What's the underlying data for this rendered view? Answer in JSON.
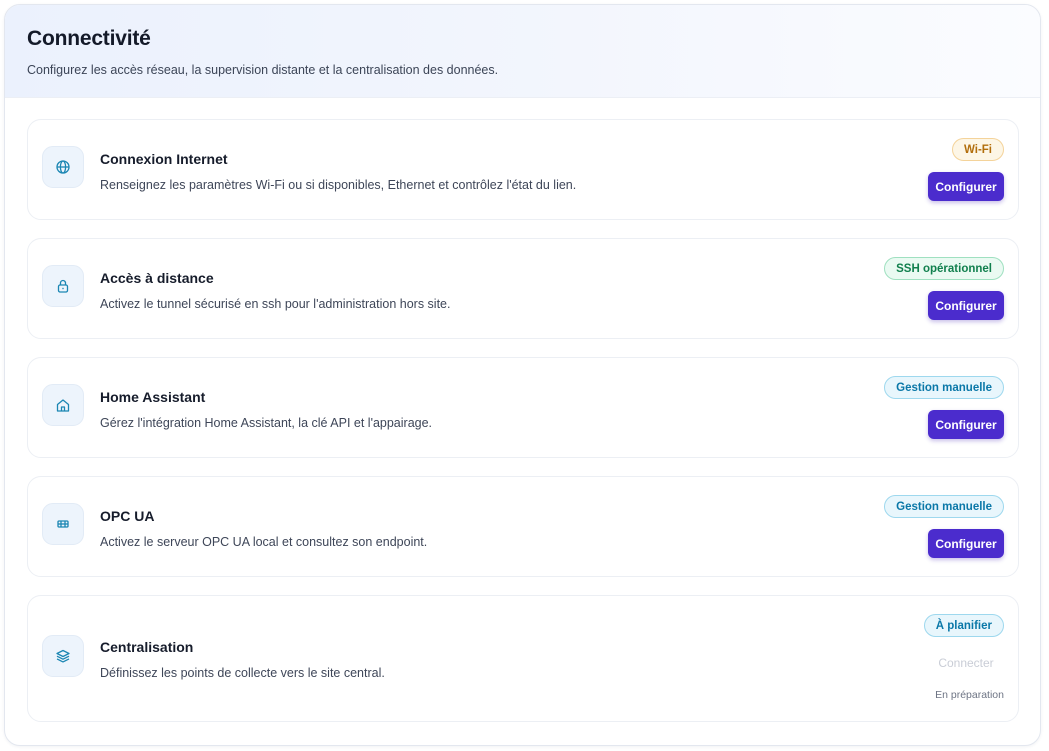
{
  "header": {
    "title": "Connectivité",
    "subtitle": "Configurez les accès réseau, la supervision distante et la centralisation des données."
  },
  "colors": {
    "accent": "#4b2ccd",
    "icon_stroke": "#1b86b3",
    "badge_amber": "#b26e0c",
    "badge_green": "#11804e",
    "badge_cyan": "#0b78a8"
  },
  "cards": [
    {
      "icon": "globe-icon",
      "title": "Connexion Internet",
      "description": "Renseignez les paramètres Wi-Fi ou si disponibles, Ethernet et contrôlez l'état du lien.",
      "badge": "Wi-Fi",
      "action": "Configurer"
    },
    {
      "icon": "lock-icon",
      "title": "Accès à distance",
      "description": "Activez le tunnel sécurisé en ssh pour l'administration hors site.",
      "badge": "SSH opérationnel",
      "action": "Configurer"
    },
    {
      "icon": "home-icon",
      "title": "Home Assistant",
      "description": "Gérez l'intégration Home Assistant, la clé API et l'appairage.",
      "badge": "Gestion manuelle",
      "action": "Configurer"
    },
    {
      "icon": "server-icon",
      "title": "OPC UA",
      "description": "Activez le serveur OPC UA local et consultez son endpoint.",
      "badge": "Gestion manuelle",
      "action": "Configurer"
    },
    {
      "icon": "layers-icon",
      "title": "Centralisation",
      "description": "Définissez les points de collecte vers le site central.",
      "badge": "À planifier",
      "action": "Connecter",
      "note": "En préparation"
    }
  ]
}
